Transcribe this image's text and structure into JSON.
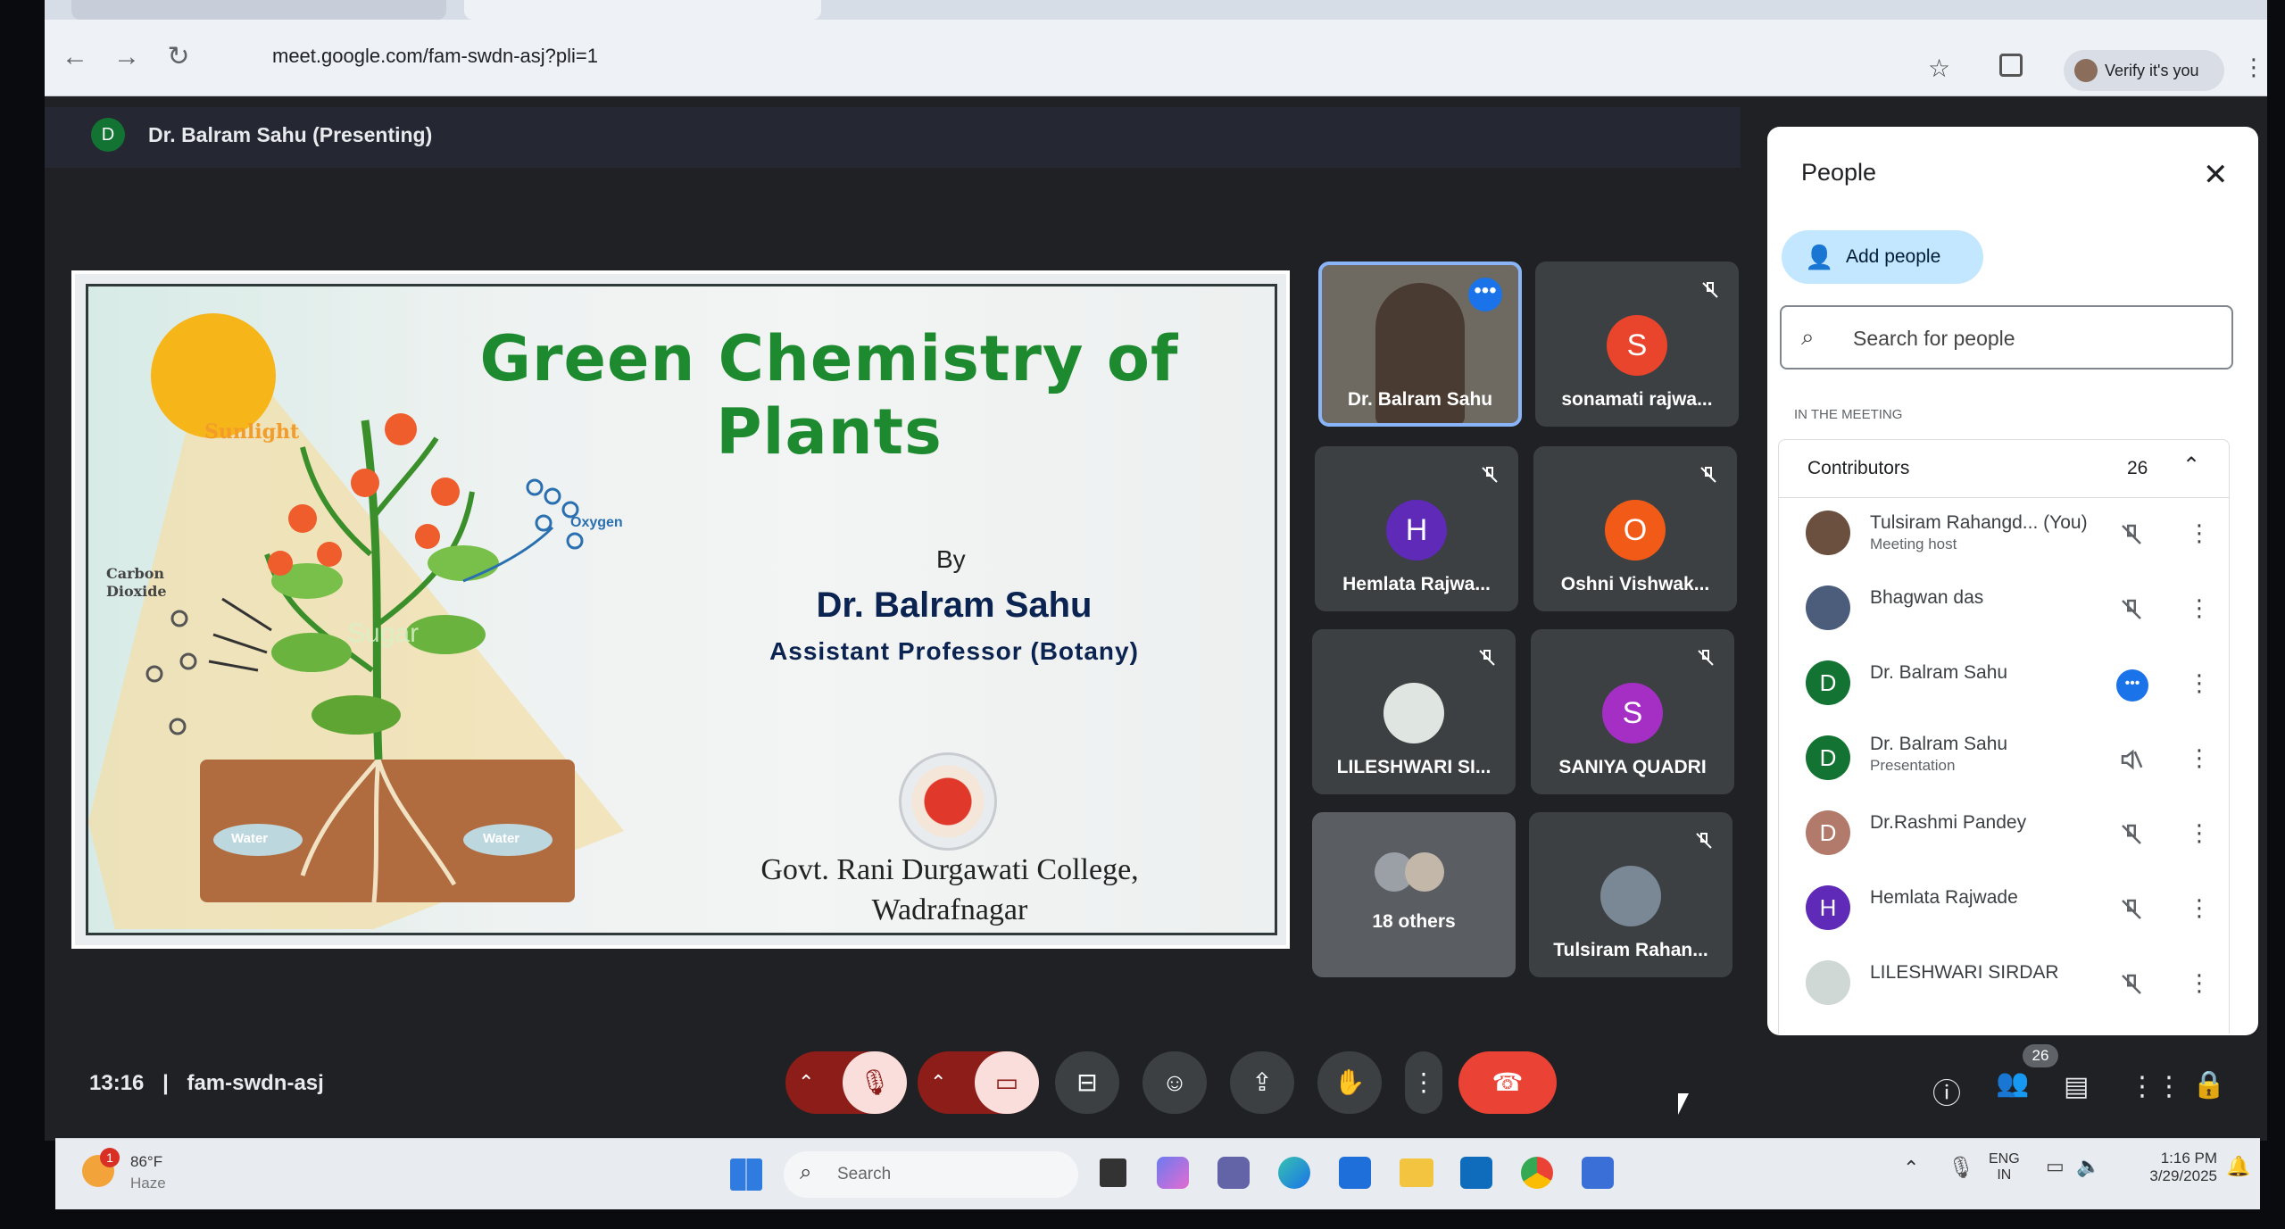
{
  "browser": {
    "url": "meet.google.com/fam-swdn-asj?pli=1",
    "profile_label": "Verify it's you"
  },
  "meet": {
    "presenter_initial": "D",
    "presenter_label": "Dr. Balram Sahu (Presenting)",
    "clock": "13:16",
    "separator": "|",
    "meeting_code": "fam-swdn-asj",
    "participant_badge": "26"
  },
  "slide": {
    "title": "Green Chemistry of Plants",
    "by": "By",
    "author": "Dr. Balram Sahu",
    "role": "Assistant Professor (Botany)",
    "college_line1": "Govt. Rani Durgawati College,",
    "college_line2": "Wadrafnagar",
    "diagram": {
      "sunlight": "Sunlight",
      "oxygen": "Oxygen",
      "carbon": "Carbon",
      "dioxide": "Dioxide",
      "sugar": "Sugar",
      "water_left": "Water",
      "water_right": "Water"
    }
  },
  "tiles": [
    {
      "name": "Dr. Balram Sahu",
      "initial": "",
      "color": "#5f6368",
      "video": true
    },
    {
      "name": "sonamati rajwa...",
      "initial": "S",
      "color": "#e8452c"
    },
    {
      "name": "Hemlata Rajwa...",
      "initial": "H",
      "color": "#5e2ab7"
    },
    {
      "name": "Oshni Vishwak...",
      "initial": "O",
      "color": "#f25a18"
    },
    {
      "name": "LILESHWARI SI...",
      "initial": "",
      "color": "#dfe6e2"
    },
    {
      "name": "SANIYA QUADRI",
      "initial": "S",
      "color": "#a52fc4"
    },
    {
      "name": "18 others",
      "initial": "",
      "color": "#9aa0a6"
    },
    {
      "name": "Tulsiram Rahan...",
      "initial": "",
      "color": "#7a8794"
    }
  ],
  "people_panel": {
    "title": "People",
    "add_people": "Add people",
    "search_placeholder": "Search for people",
    "section_label": "IN THE MEETING",
    "group_label": "Contributors",
    "group_count": "26",
    "people": [
      {
        "name": "Tulsiram Rahangd...",
        "you": "(You)",
        "sub": "Meeting host",
        "initial": "",
        "color": "#6b4f3f"
      },
      {
        "name": "Bhagwan das",
        "sub": "",
        "initial": "",
        "color": "#4b5d7a"
      },
      {
        "name": "Dr. Balram Sahu",
        "sub": "",
        "initial": "D",
        "color": "#137333"
      },
      {
        "name": "Dr. Balram Sahu",
        "sub": "Presentation",
        "initial": "D",
        "color": "#137333"
      },
      {
        "name": "Dr.Rashmi Pandey",
        "sub": "",
        "initial": "D",
        "color": "#b27a6a"
      },
      {
        "name": "Hemlata Rajwade",
        "sub": "",
        "initial": "H",
        "color": "#5e2ab7"
      },
      {
        "name": "LILESHWARI SIRDAR",
        "sub": "",
        "initial": "",
        "color": "#cfd8d4"
      }
    ]
  },
  "taskbar": {
    "weather_temp": "86°F",
    "weather_desc": "Haze",
    "weather_badge": "1",
    "search_placeholder": "Search",
    "lang_top": "ENG",
    "lang_bottom": "IN",
    "time": "1:16 PM",
    "date": "3/29/2025"
  },
  "colors": {
    "meet_bg": "#202124",
    "end_call": "#ea4335",
    "title_green": "#1d8a2f",
    "author_navy": "#0b2350",
    "accent_blue": "#1a73e8"
  }
}
